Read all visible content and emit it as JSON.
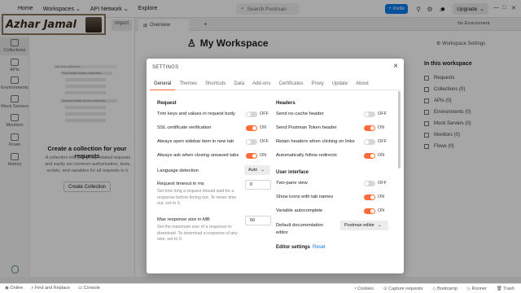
{
  "topbar": {
    "nav": [
      "Home",
      "Workspaces ⌄",
      "API Network ⌄",
      "Explore"
    ],
    "search_placeholder": "Search Postman",
    "invite_label": "Invite",
    "upgrade_label": "Upgrade"
  },
  "badge": {
    "name": "Azhar Jamal"
  },
  "sidebar": {
    "items": [
      {
        "label": "Collections"
      },
      {
        "label": "APIs"
      },
      {
        "label": "Environments"
      },
      {
        "label": "Mock Servers"
      },
      {
        "label": "Monitors"
      },
      {
        "label": "Flows"
      },
      {
        "label": "History"
      }
    ]
  },
  "leftpanel": {
    "import_label": "Import",
    "illustration_rows": [
      "My first collection",
      "First folder inside collection",
      "Second folder inside collection"
    ],
    "empty_title": "Create a collection for your requests",
    "empty_desc": "A collection lets you group related requests and easily set common authorization, tests, scripts, and variables for all requests in it.",
    "create_button": "Create Collection"
  },
  "main": {
    "tab_label": "Overview",
    "environment": "No Environment",
    "workspace_title": "My Workspace",
    "workspace_settings": "Workspace Settings",
    "info_title": "In this workspace",
    "info_items": [
      "Requests",
      "Collections (0)",
      "APIs (0)",
      "Environments (0)",
      "Mock Servers (0)",
      "Monitors (0)",
      "Flows (0)"
    ]
  },
  "modal": {
    "title": "SETTINGS",
    "tabs": [
      "General",
      "Themes",
      "Shortcuts",
      "Data",
      "Add-ons",
      "Certificates",
      "Proxy",
      "Update",
      "About"
    ],
    "request": {
      "head": "Request",
      "trim_label": "Trim keys and values in request body",
      "trim_state": "OFF",
      "ssl_label": "SSL certificate verification",
      "ssl_state": "ON",
      "sidebar_label": "Always open sidebar item in new tab",
      "sidebar_state": "OFF",
      "unsaved_label": "Always ask when closing unsaved tabs",
      "unsaved_state": "ON",
      "lang_label": "Language detection",
      "lang_value": "Auto",
      "timeout_label": "Request timeout in ms",
      "timeout_desc": "Set how long a request should wait for a response before timing out. To never time out, set to 0.",
      "timeout_value": "0",
      "maxsize_label": "Max response size in MB",
      "maxsize_desc": "Set the maximum size of a response to download. To download a response of any size, set to 0.",
      "maxsize_value": "50"
    },
    "headers": {
      "head": "Headers",
      "nocache_label": "Send no-cache header",
      "nocache_state": "OFF",
      "token_label": "Send Postman Token header",
      "token_state": "ON",
      "retain_label": "Retain headers when clicking on links",
      "retain_state": "OFF",
      "redirects_label": "Automatically follow redirects",
      "redirects_state": "ON"
    },
    "ui": {
      "head": "User interface",
      "twopane_label": "Two-pane view",
      "twopane_state": "OFF",
      "icons_label": "Show icons with tab names",
      "icons_state": "ON",
      "autocomplete_label": "Variable autocomplete",
      "autocomplete_state": "ON",
      "editor_label": "Default documentation editor",
      "editor_value": "Postman editor"
    },
    "editor_head": "Editor settings",
    "editor_reset": "Reset"
  },
  "statusbar": {
    "left": [
      "Online",
      "Find and Replace",
      "Console"
    ],
    "right": [
      "Cookies",
      "Capture requests",
      "Bootcamp",
      "Runner",
      "Trash"
    ]
  }
}
